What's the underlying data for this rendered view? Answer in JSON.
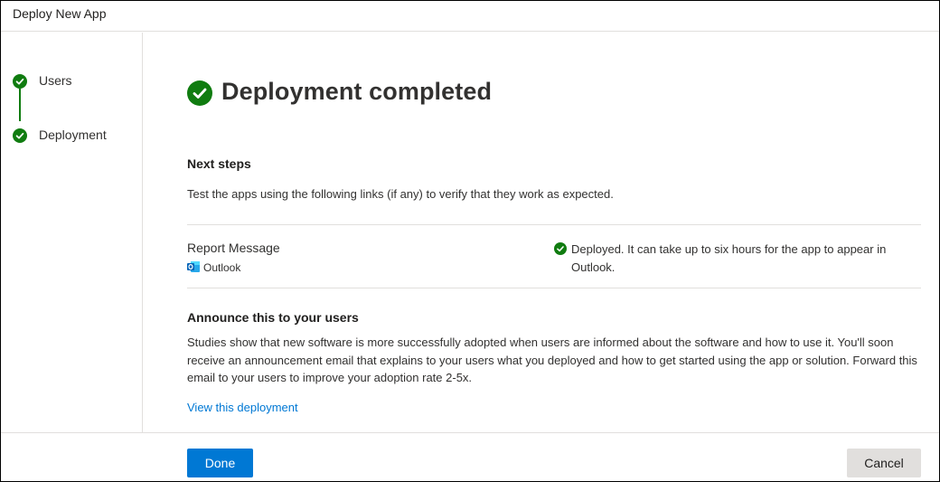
{
  "window": {
    "title": "Deploy New App"
  },
  "stepper": {
    "steps": [
      {
        "label": "Users",
        "status": "complete"
      },
      {
        "label": "Deployment",
        "status": "complete"
      }
    ]
  },
  "main": {
    "heading": "Deployment completed",
    "next_steps": {
      "title": "Next steps",
      "description": "Test the apps using the following links (if any) to verify that they work as expected."
    },
    "report": {
      "title": "Report Message",
      "app_name": "Outlook",
      "status_text": "Deployed. It can take up to six hours for the app to appear in Outlook."
    },
    "announce": {
      "title": "Announce this to your users",
      "body": "Studies show that new software is more successfully adopted when users are informed about the software and how to use it. You'll soon receive an announcement email that explains to your users what you deployed and how to get started using the app or solution. Forward this email to your users to improve your adoption rate 2-5x."
    },
    "link_label": "View this deployment"
  },
  "footer": {
    "done_label": "Done",
    "cancel_label": "Cancel"
  },
  "colors": {
    "success": "#107c10",
    "accent": "#0078d4",
    "outlook_blue": "#0364b8",
    "divider": "#e1dfdd",
    "cancel_bg": "#e1dfdd"
  },
  "icons": {
    "step_complete": "check-circle-icon",
    "heading": "check-circle-icon",
    "app": "outlook-icon",
    "status": "check-circle-icon"
  }
}
